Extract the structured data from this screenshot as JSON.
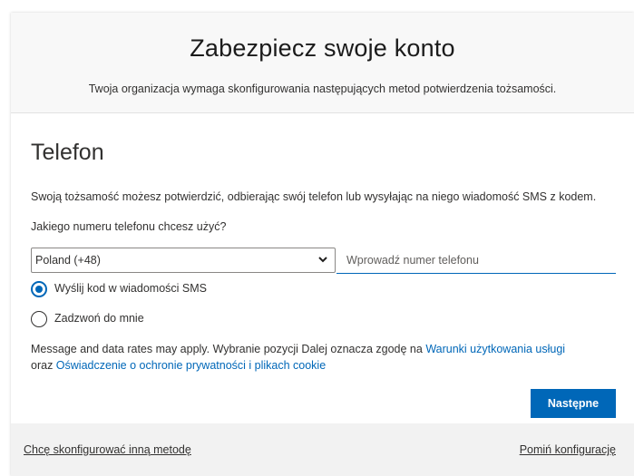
{
  "header": {
    "title": "Zabezpiecz swoje konto",
    "subtitle": "Twoja organizacja wymaga skonfigurowania następujących metod potwierdzenia tożsamości."
  },
  "section": {
    "title": "Telefon",
    "description": "Swoją tożsamość możesz potwierdzić, odbierając swój telefon lub wysyłając na niego wiadomość SMS z kodem.",
    "question": "Jakiego numeru telefonu chcesz użyć?"
  },
  "country_select": {
    "value": "Poland (+48)",
    "icon": "chevron-down-icon"
  },
  "phone_input": {
    "value": "",
    "placeholder": "Wprowadź numer telefonu"
  },
  "radio": {
    "sms": {
      "label": "Wyślij kod w wiadomości SMS",
      "checked": true
    },
    "call": {
      "label": "Zadzwoń do mnie",
      "checked": false
    }
  },
  "legal": {
    "text_before": "Message and data rates may apply. Wybranie pozycji Dalej oznacza zgodę na ",
    "terms_link": "Warunki użytkowania usługi",
    "text_middle": " oraz ",
    "privacy_link": "Oświadczenie o ochronie prywatności i plikach cookie"
  },
  "buttons": {
    "next": "Następne"
  },
  "footer": {
    "other_method": "Chcę skonfigurować inną metodę",
    "skip": "Pomiń konfigurację"
  },
  "colors": {
    "accent": "#0067b8",
    "header_bg": "#f8f8f8",
    "footer_bg": "#f2f2f2"
  }
}
